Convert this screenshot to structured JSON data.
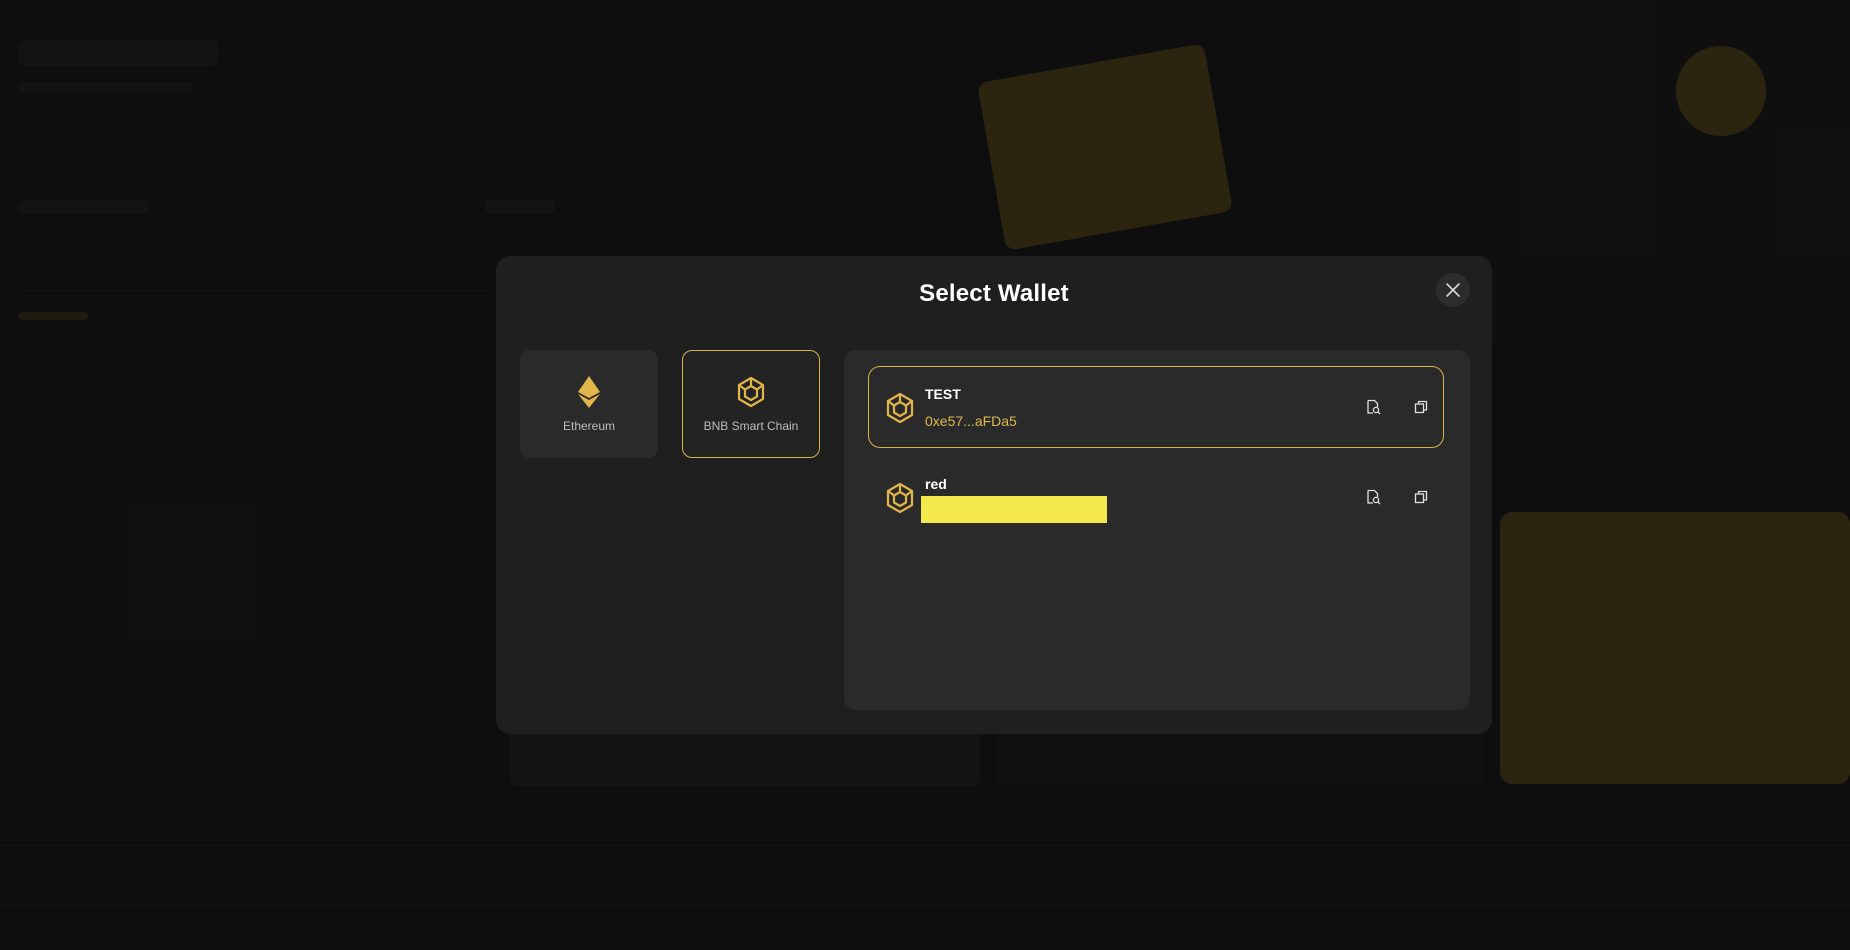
{
  "modal": {
    "title": "Select Wallet"
  },
  "chains": [
    {
      "label": "Ethereum",
      "icon": "ethereum-icon",
      "selected": false
    },
    {
      "label": "BNB Smart Chain",
      "icon": "bnb-icon",
      "selected": true
    }
  ],
  "wallets": [
    {
      "name": "TEST",
      "address": "0xe57...aFDa5",
      "icon": "bnb-icon",
      "selected": true
    },
    {
      "name": "red",
      "address": "",
      "icon": "bnb-icon",
      "selected": false,
      "address_redacted": true
    }
  ],
  "colors": {
    "accent": "#d8b24a",
    "address": "#e0b84f",
    "modal_bg": "#1f1f20",
    "panel_bg": "#2a2a2b",
    "redaction": "#f2e84c"
  }
}
